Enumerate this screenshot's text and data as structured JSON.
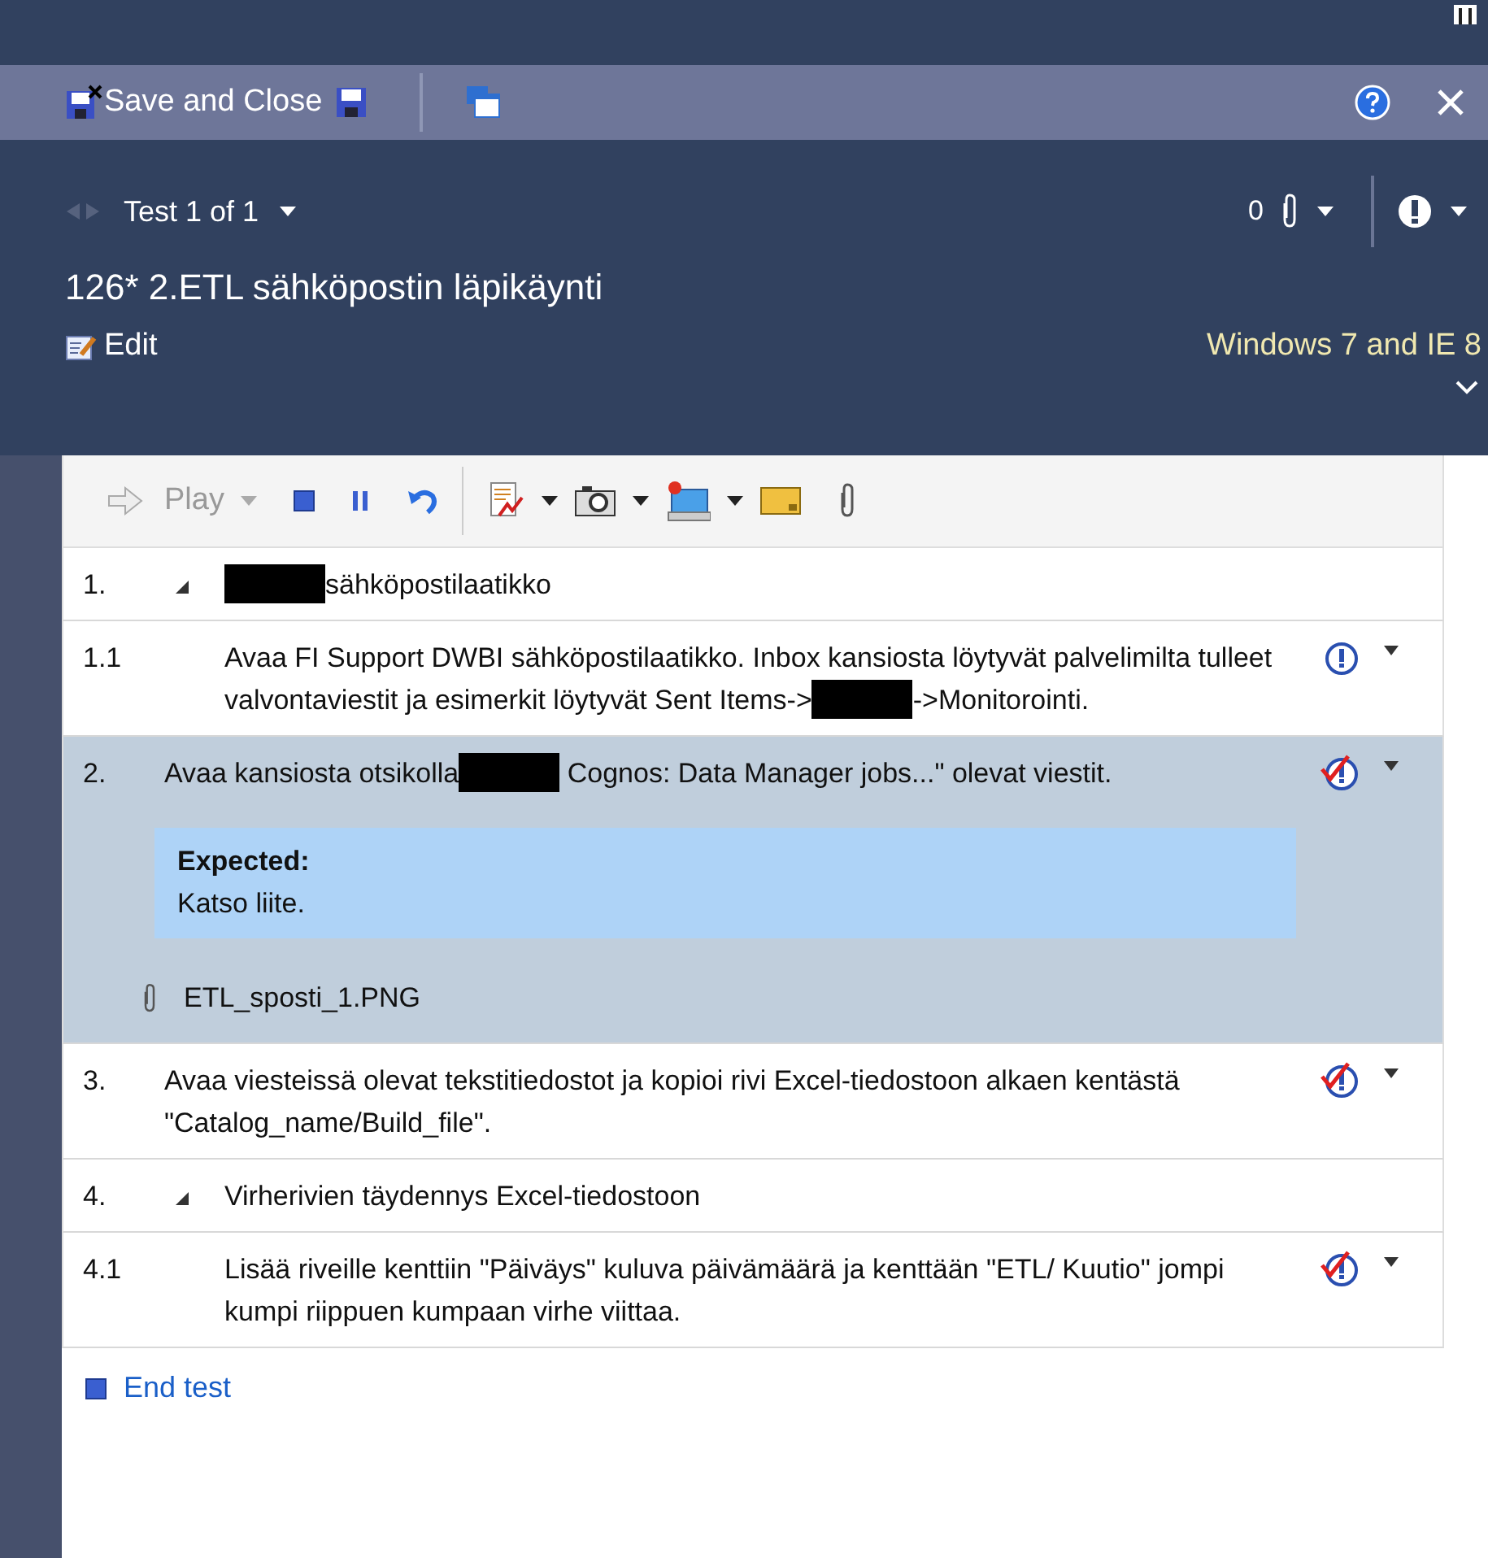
{
  "toolbar": {
    "save_close": "Save and Close"
  },
  "nav": {
    "test_label": "Test 1 of 1",
    "attachments_count": "0"
  },
  "title": "126* 2.ETL sähköpostin läpikäynti",
  "edit": "Edit",
  "configuration": "Windows 7 and IE 8",
  "runner_toolbar": {
    "play": "Play",
    "play_disabled": true
  },
  "steps": [
    {
      "number": "1.",
      "kind": "group",
      "expanded": true,
      "selected": false,
      "parts": [
        {
          "kind": "redacted"
        },
        {
          "kind": "text",
          "text": "sähköpostilaatikko"
        }
      ],
      "children": [
        {
          "number": "1.1",
          "kind": "step",
          "selected": false,
          "passed": false,
          "parts": [
            {
              "kind": "text",
              "text": "Avaa FI Support DWBI sähköpostilaatikko. Inbox kansiosta löytyvät palvelimilta tulleet valvontaviestit ja esimerkit löytyvät Sent Items->"
            },
            {
              "kind": "redacted"
            },
            {
              "kind": "text",
              "text": "->Monitorointi."
            }
          ]
        }
      ]
    },
    {
      "number": "2.",
      "kind": "step",
      "selected": true,
      "passed": true,
      "parts": [
        {
          "kind": "text",
          "text": "Avaa kansiosta otsikolla"
        },
        {
          "kind": "redacted"
        },
        {
          "kind": "text",
          "text": " Cognos: Data Manager jobs...\" olevat viestit."
        }
      ],
      "expected_label": "Expected:",
      "expected": "Katso liite.",
      "attachment": "ETL_sposti_1.PNG"
    },
    {
      "number": "3.",
      "kind": "step",
      "selected": false,
      "passed": true,
      "parts": [
        {
          "kind": "text",
          "text": "Avaa viesteissä olevat tekstitiedostot ja kopioi rivi Excel-tiedostoon alkaen kentästä \"Catalog_name/Build_file\"."
        }
      ]
    },
    {
      "number": "4.",
      "kind": "group",
      "expanded": true,
      "selected": false,
      "parts": [
        {
          "kind": "text",
          "text": "Virherivien täydennys Excel-tiedostoon"
        }
      ],
      "children": [
        {
          "number": "4.1",
          "kind": "step",
          "selected": false,
          "passed": true,
          "parts": [
            {
              "kind": "text",
              "text": "Lisää riveille kenttiin \"Päiväys\" kuluva päivämäärä ja kenttään \"ETL/ Kuutio\" jompi kumpi riippuen kumpaan virhe viittaa."
            }
          ]
        }
      ]
    }
  ],
  "end_test": "End test"
}
